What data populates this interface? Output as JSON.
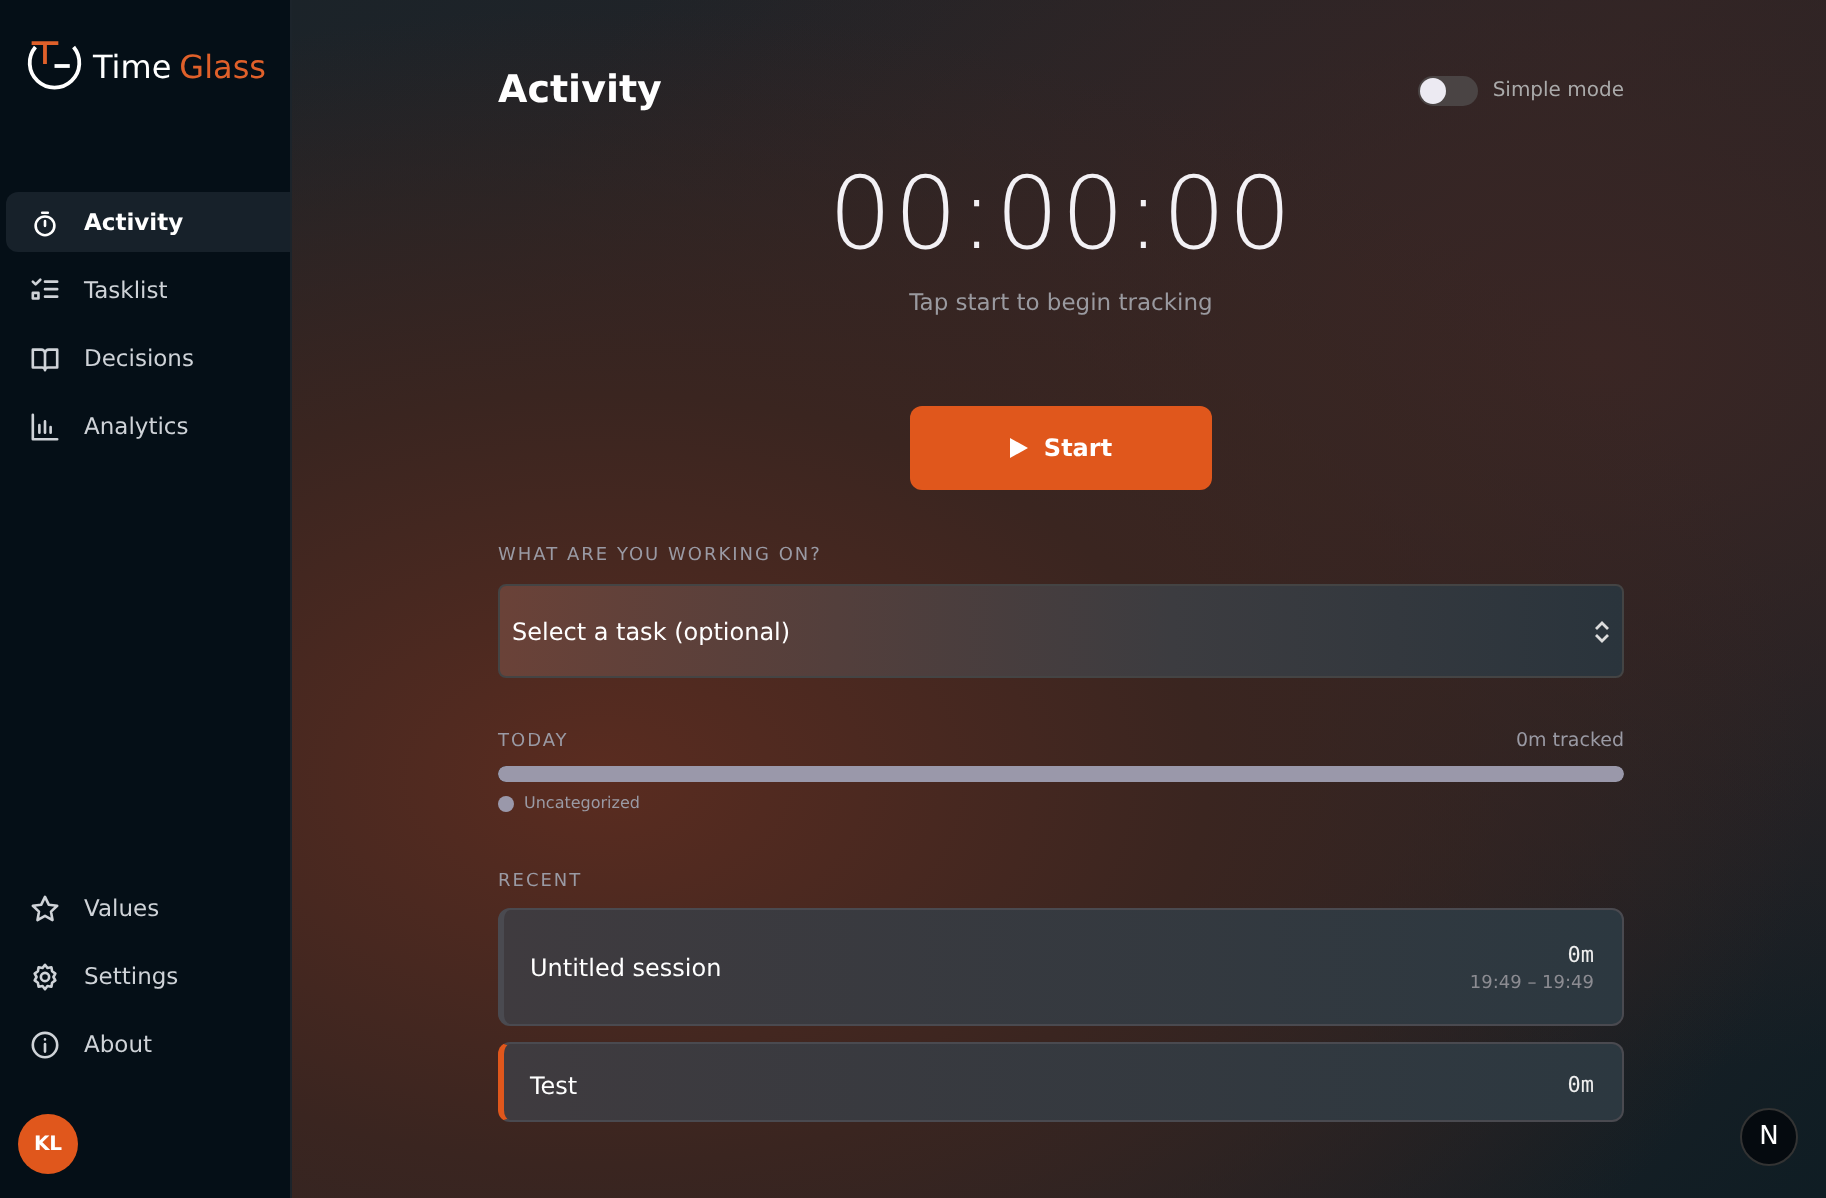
{
  "brand": {
    "name_part_1": "Time",
    "name_part_2": "Glass"
  },
  "sidebar": {
    "items": [
      {
        "label": "Activity",
        "selected": true
      },
      {
        "label": "Tasklist",
        "selected": false
      },
      {
        "label": "Decisions",
        "selected": false
      },
      {
        "label": "Analytics",
        "selected": false
      }
    ],
    "bottom_items": [
      {
        "label": "Values",
        "selected": false
      },
      {
        "label": "Settings",
        "selected": false
      },
      {
        "label": "About",
        "selected": false
      }
    ],
    "avatar": "KL"
  },
  "page_title": "Activity",
  "simple_mode": {
    "label": "Simple mode",
    "on": false
  },
  "timer": {
    "time": "00:00:00",
    "hint": "Tap start to begin tracking",
    "button": "Start"
  },
  "task_picker": {
    "label": "WHAT ARE YOU WORKING ON?",
    "placeholder": "Select a task (optional)"
  },
  "today": {
    "label": "TODAY",
    "tracked": "0m tracked",
    "segments": [
      {
        "name": "Uncategorized",
        "color": "#9a98aa",
        "level": 1
      }
    ]
  },
  "recent": {
    "label": "RECENT",
    "sessions": [
      {
        "title": "Untitled session",
        "duration": "0m",
        "range": "19:49 – 19:49",
        "highlighted": false
      },
      {
        "title": "Test",
        "duration": "0m",
        "highlighted": true
      }
    ]
  },
  "corner_badge": "N"
}
